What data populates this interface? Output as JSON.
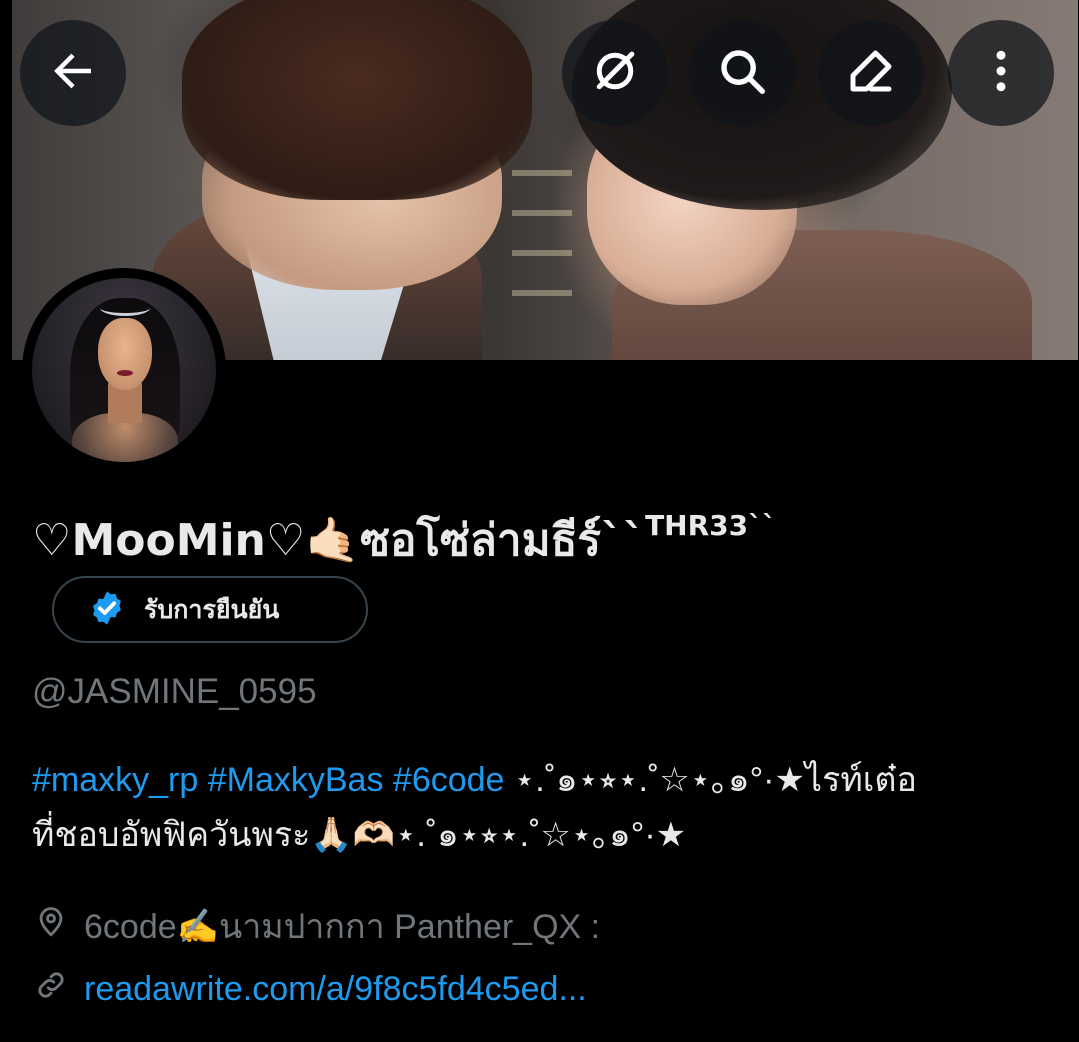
{
  "profile": {
    "display_name": "♡MooMin♡🤙🏻ซอโซ่ล่ามธีร์``",
    "display_name_sup": "THR33``",
    "verified_label": "รับการยืนยัน",
    "handle": "@JASMINE_0595"
  },
  "bio": {
    "hashtags": [
      "#maxky_rp",
      "#MaxkyBas",
      "#6code"
    ],
    "text_line1": " ⋆.˚๑⋆⭒⋆.˚☆⋆｡๑°·★ไรท์เต๋อ",
    "text_line2": "ที่ชอบอัพฟิควันพระ🙏🏻🫶🏻⋆.˚๑⋆⭒⋆.˚☆⋆｡๑°·★"
  },
  "meta": {
    "location": "6code✍️นามปากกา Panther_QX :",
    "website": "readawrite.com/a/9f8c5fd4c5ed..."
  },
  "toolbar": {
    "back_icon": "arrow-left-icon",
    "grok_icon": "grok-icon",
    "search_icon": "search-icon",
    "edit_icon": "pencil-icon",
    "more_icon": "more-vertical-icon"
  },
  "colors": {
    "background": "#000000",
    "link": "#1d9bf0",
    "secondary_text": "#71767b",
    "primary_text": "#e7e9ea"
  }
}
